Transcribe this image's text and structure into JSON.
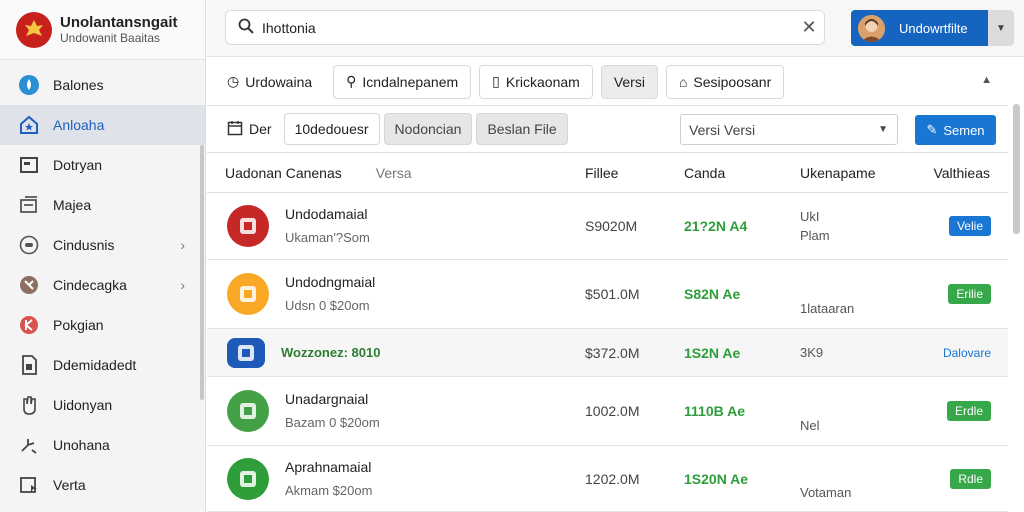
{
  "brand": {
    "title": "Unolantansngait",
    "subtitle": "Undowanit Baaitas"
  },
  "sidebar": {
    "items": [
      {
        "label": "Balones",
        "icon": "circle-drop-icon",
        "active": false,
        "chevron": false
      },
      {
        "label": "Anloaha",
        "icon": "home-star-icon",
        "active": true,
        "chevron": false
      },
      {
        "label": "Dotryan",
        "icon": "square-window-icon",
        "active": false,
        "chevron": false
      },
      {
        "label": "Majea",
        "icon": "edit-panel-icon",
        "active": false,
        "chevron": false
      },
      {
        "label": "Cindusnis",
        "icon": "toggle-icon",
        "active": false,
        "chevron": true
      },
      {
        "label": "Cindecagka",
        "icon": "crossed-circle-icon",
        "active": false,
        "chevron": true
      },
      {
        "label": "Pokgian",
        "icon": "k-circle-icon",
        "active": false,
        "chevron": false
      },
      {
        "label": "Ddemidadedt",
        "icon": "document-icon",
        "active": false,
        "chevron": false
      },
      {
        "label": "Uidonyan",
        "icon": "hand-icon",
        "active": false,
        "chevron": false
      },
      {
        "label": "Unohana",
        "icon": "gesture-icon",
        "active": false,
        "chevron": false
      },
      {
        "label": "Verta",
        "icon": "box-icon",
        "active": false,
        "chevron": false
      }
    ]
  },
  "search": {
    "value": "Ihottonia",
    "placeholder": ""
  },
  "user": {
    "label": "Undowrtfilte"
  },
  "tabs": [
    {
      "label": "Urdowaina",
      "icon": "clock-icon",
      "style": "plain"
    },
    {
      "label": "Icndalnepanem",
      "icon": "person-icon",
      "style": "outline"
    },
    {
      "label": "Krickaonam",
      "icon": "doc-icon",
      "style": "outline"
    },
    {
      "label": "Versi",
      "icon": "",
      "style": "grey"
    },
    {
      "label": "Sesipoosanr",
      "icon": "tag-icon",
      "style": "outline"
    }
  ],
  "filters": {
    "label": "Der",
    "buttons": [
      {
        "label": "10dedouesr",
        "style": "outline"
      },
      {
        "label": "Nodoncian",
        "style": "grey"
      },
      {
        "label": "Beslan File",
        "style": "grey"
      }
    ],
    "select_value": "Versi Versi",
    "primary_label": "Semen"
  },
  "table": {
    "headers": {
      "name": "Uadonan Canenas",
      "name_sub": "Versa",
      "file": "Fillee",
      "count": "Canda",
      "version": "Ukenapame",
      "status": "Valthieas"
    },
    "rows": [
      {
        "name": "Undodamaial",
        "sub": "Ukaman'?Som",
        "file": "S9020M",
        "count": "21?2N A4",
        "ver1": "UkI",
        "ver2": "Plam",
        "badge": "Velie",
        "badge_style": "blue",
        "icon_color": "#c62828",
        "alt": false,
        "green_name": false
      },
      {
        "name": "Undodngmaial",
        "sub": "Udsn 0 $20om",
        "file": "$501.0M",
        "count": "S82N Ae",
        "ver1": "",
        "ver2": "1lataaran",
        "badge": "Erilie",
        "badge_style": "green",
        "icon_color": "#f9a825",
        "alt": false,
        "green_name": false
      },
      {
        "name": "Wozzonez: 8010",
        "sub": "",
        "file": "$372.0M",
        "count": "1S2N Ae",
        "ver1": "3K9",
        "ver2": "",
        "badge": "Dalovare",
        "badge_style": "link",
        "icon_color": "#1e5bb8",
        "alt": true,
        "green_name": true
      },
      {
        "name": "Unadargnaial",
        "sub": "Bazam 0 $20om",
        "file": "1002.0M",
        "count": "1110B Ae",
        "ver1": "",
        "ver2": "Nel",
        "badge": "Erdle",
        "badge_style": "green",
        "icon_color": "#43a047",
        "alt": false,
        "green_name": false
      },
      {
        "name": "Aprahnamaial",
        "sub": "Akmam $20om",
        "file": "1202.0M",
        "count": "1S20N Ae",
        "ver1": "",
        "ver2": "Votaman",
        "badge": "Rdle",
        "badge_style": "green",
        "icon_color": "#2e9d3a",
        "alt": false,
        "green_name": false
      }
    ]
  }
}
